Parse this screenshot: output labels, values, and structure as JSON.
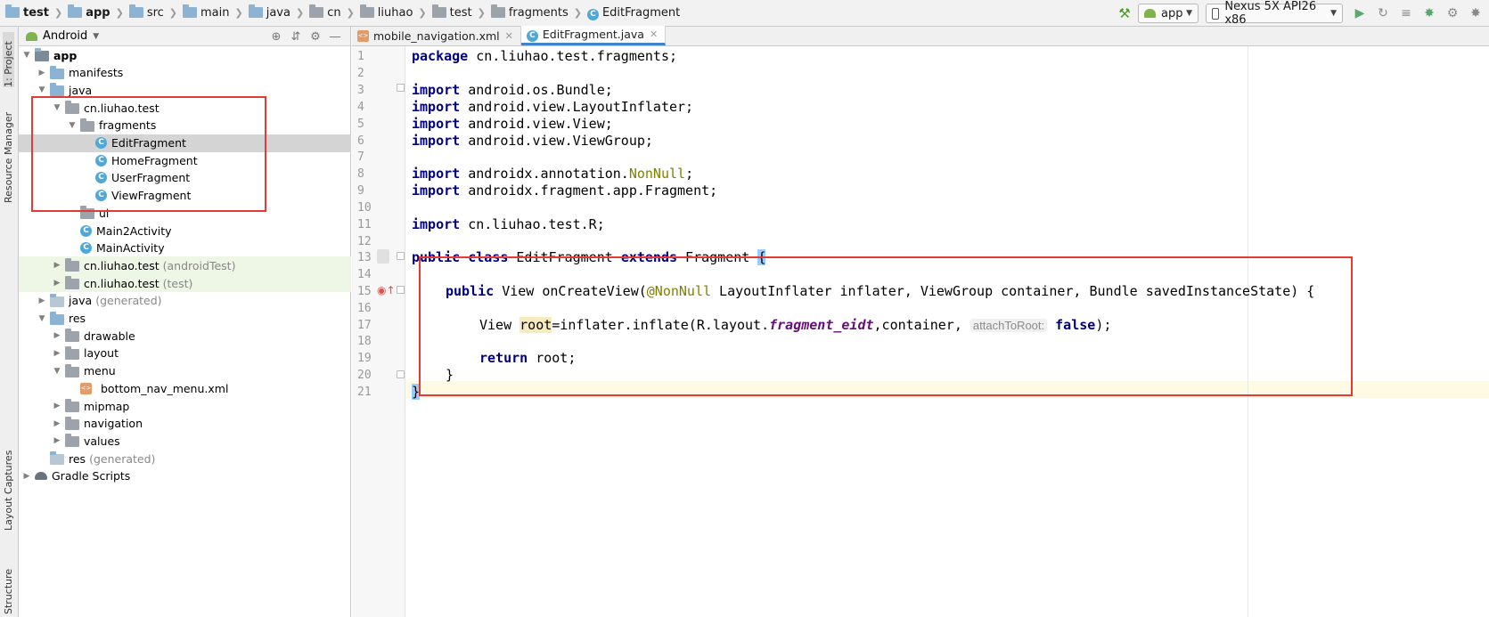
{
  "breadcrumbs": [
    {
      "label": "test",
      "bold": true,
      "icon": "project-icon"
    },
    {
      "label": "app",
      "bold": true,
      "icon": "module-folder-icon"
    },
    {
      "label": "src",
      "icon": "folder-icon"
    },
    {
      "label": "main",
      "icon": "folder-icon"
    },
    {
      "label": "java",
      "icon": "folder-icon"
    },
    {
      "label": "cn",
      "icon": "package-icon"
    },
    {
      "label": "liuhao",
      "icon": "package-icon"
    },
    {
      "label": "test",
      "icon": "package-icon"
    },
    {
      "label": "fragments",
      "icon": "package-icon"
    },
    {
      "label": "EditFragment",
      "icon": "class-icon"
    }
  ],
  "toolbar": {
    "run_config": "app",
    "device": "Nexus 5X API26 x86"
  },
  "left_strip": {
    "project_tab": "1: Project",
    "resource_manager_tab": "Resource Manager",
    "layout_captures_tab": "Layout Captures",
    "structure_tab": "Structure"
  },
  "project_panel": {
    "view_mode": "Android",
    "tree": [
      {
        "label": "app",
        "level": 0,
        "expanded": true,
        "bold": true,
        "icon": "module"
      },
      {
        "label": "manifests",
        "level": 1,
        "expanded": false,
        "icon": "folder"
      },
      {
        "label": "java",
        "level": 1,
        "expanded": true,
        "icon": "folder"
      },
      {
        "label": "cn.liuhao.test",
        "level": 2,
        "expanded": true,
        "icon": "package"
      },
      {
        "label": "fragments",
        "level": 3,
        "expanded": true,
        "icon": "package"
      },
      {
        "label": "EditFragment",
        "level": 4,
        "icon": "class",
        "selected": true
      },
      {
        "label": "HomeFragment",
        "level": 4,
        "icon": "class"
      },
      {
        "label": "UserFragment",
        "level": 4,
        "icon": "class"
      },
      {
        "label": "ViewFragment",
        "level": 4,
        "icon": "class"
      },
      {
        "label": "ui",
        "level": 3,
        "icon": "package"
      },
      {
        "label": "Main2Activity",
        "level": 3,
        "icon": "class"
      },
      {
        "label": "MainActivity",
        "level": 3,
        "icon": "class"
      },
      {
        "label": "cn.liuhao.test",
        "suffix": "(androidTest)",
        "level": 2,
        "expanded": false,
        "icon": "package",
        "tinted": true
      },
      {
        "label": "cn.liuhao.test",
        "suffix": "(test)",
        "level": 2,
        "expanded": false,
        "icon": "package",
        "tinted": true
      },
      {
        "label": "java",
        "suffix": "(generated)",
        "level": 1,
        "expanded": false,
        "icon": "folder-generated"
      },
      {
        "label": "res",
        "level": 1,
        "expanded": true,
        "icon": "folder"
      },
      {
        "label": "drawable",
        "level": 2,
        "expanded": false,
        "icon": "package"
      },
      {
        "label": "layout",
        "level": 2,
        "expanded": false,
        "icon": "package"
      },
      {
        "label": "menu",
        "level": 2,
        "expanded": true,
        "icon": "package"
      },
      {
        "label": "bottom_nav_menu.xml",
        "level": 3,
        "icon": "xml"
      },
      {
        "label": "mipmap",
        "level": 2,
        "expanded": false,
        "icon": "package"
      },
      {
        "label": "navigation",
        "level": 2,
        "expanded": false,
        "icon": "package"
      },
      {
        "label": "values",
        "level": 2,
        "expanded": false,
        "icon": "package"
      },
      {
        "label": "res",
        "suffix": "(generated)",
        "level": 1,
        "icon": "folder-generated"
      },
      {
        "label": "Gradle Scripts",
        "level": 0,
        "expanded": false,
        "icon": "gradle"
      }
    ]
  },
  "editor": {
    "tabs": [
      {
        "label": "mobile_navigation.xml",
        "active": false,
        "icon": "xml"
      },
      {
        "label": "EditFragment.java",
        "active": true,
        "icon": "class"
      }
    ],
    "line_numbers": [
      "1",
      "2",
      "3",
      "4",
      "5",
      "6",
      "7",
      "8",
      "9",
      "10",
      "11",
      "12",
      "13",
      "14",
      "15",
      "16",
      "17",
      "18",
      "19",
      "20",
      "21"
    ],
    "code": {
      "l1_kw": "package",
      "l1_rest": " cn.liuhao.test.fragments;",
      "import_kw": "import",
      "l3": " android.os.Bundle;",
      "l4": " android.view.LayoutInflater;",
      "l5": " android.view.View;",
      "l6": " android.view.ViewGroup;",
      "l8_a": " androidx.annotation.",
      "l8_ann": "NonNull",
      "l8_b": ";",
      "l9": " androidx.fragment.app.Fragment;",
      "l11": " cn.liuhao.test.R;",
      "l13_public": "public",
      "l13_class": "class",
      "l13_name": " EditFragment ",
      "l13_extends": "extends",
      "l13_rest": " Fragment ",
      "l13_brace": "{",
      "l15_public": "public",
      "l15_a": " View onCreateView(",
      "l15_ann": "@NonNull",
      "l15_b": " LayoutInflater inflater, ViewGroup container, Bundle savedInstanceState) {",
      "l17_a": "View ",
      "l17_var": "root",
      "l17_b": "=inflater.inflate(R.layout.",
      "l17_field": "fragment_eidt",
      "l17_c": ",container, ",
      "l17_hint": "attachToRoot:",
      "l17_false": "false",
      "l17_d": ");",
      "l19_return": "return",
      "l19_rest": " root;",
      "l20": "}",
      "l21": "}"
    }
  }
}
